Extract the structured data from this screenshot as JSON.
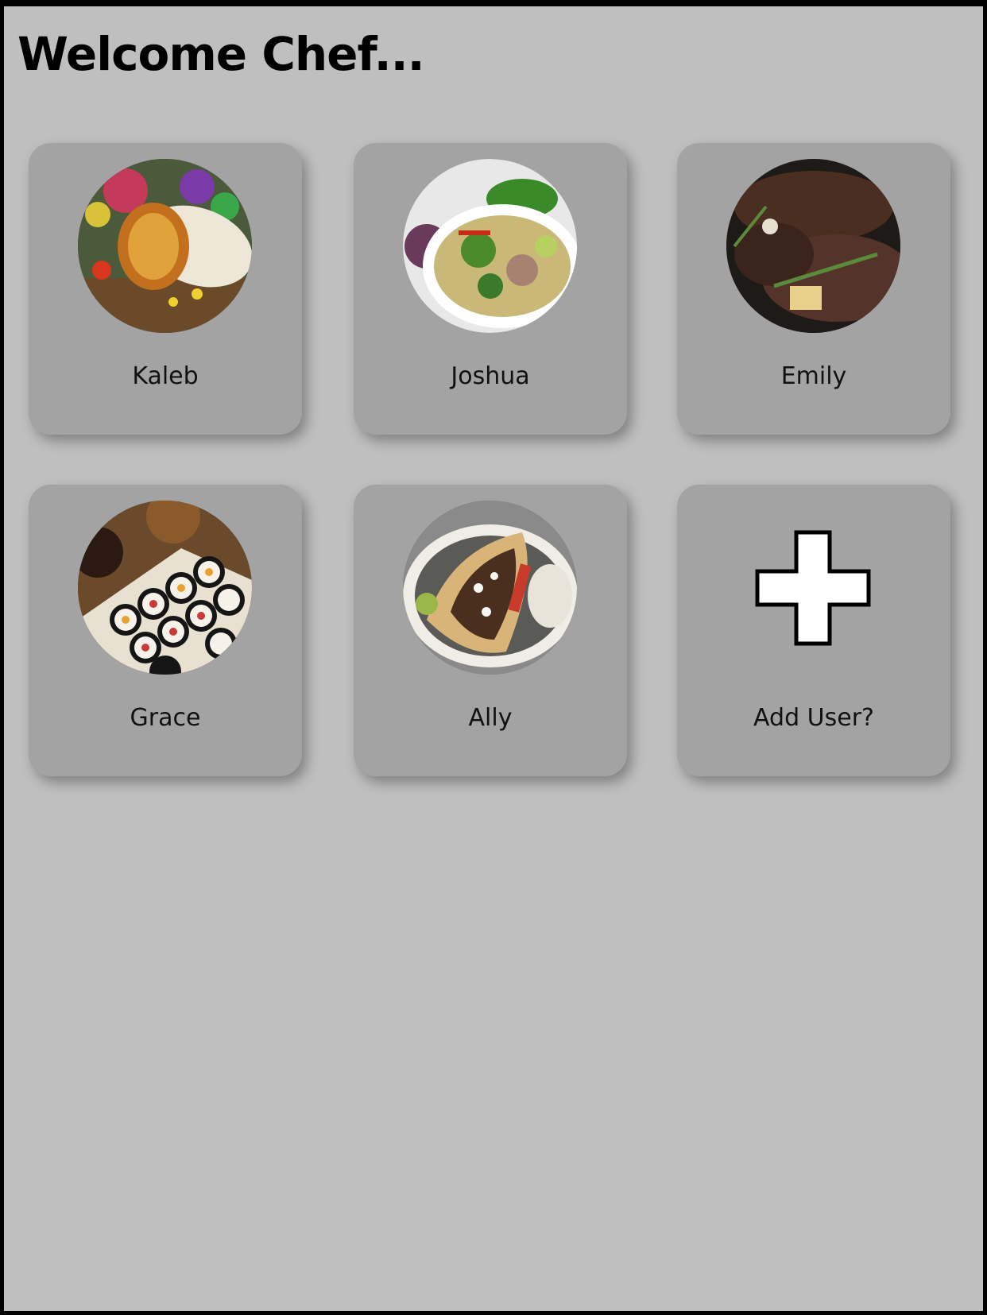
{
  "header": {
    "title": "Welcome Chef..."
  },
  "profiles": [
    {
      "name": "Kaleb",
      "photo": "burrito-photo"
    },
    {
      "name": "Joshua",
      "photo": "pho-soup-photo"
    },
    {
      "name": "Emily",
      "photo": "steak-photo"
    },
    {
      "name": "Grace",
      "photo": "sushi-photo"
    },
    {
      "name": "Ally",
      "photo": "gyro-photo"
    }
  ],
  "add_user": {
    "label": "Add User?",
    "icon": "plus-icon"
  },
  "colors": {
    "background": "#bfbfbf",
    "card": "#a3a3a3",
    "border": "#000000",
    "text": "#111111"
  }
}
